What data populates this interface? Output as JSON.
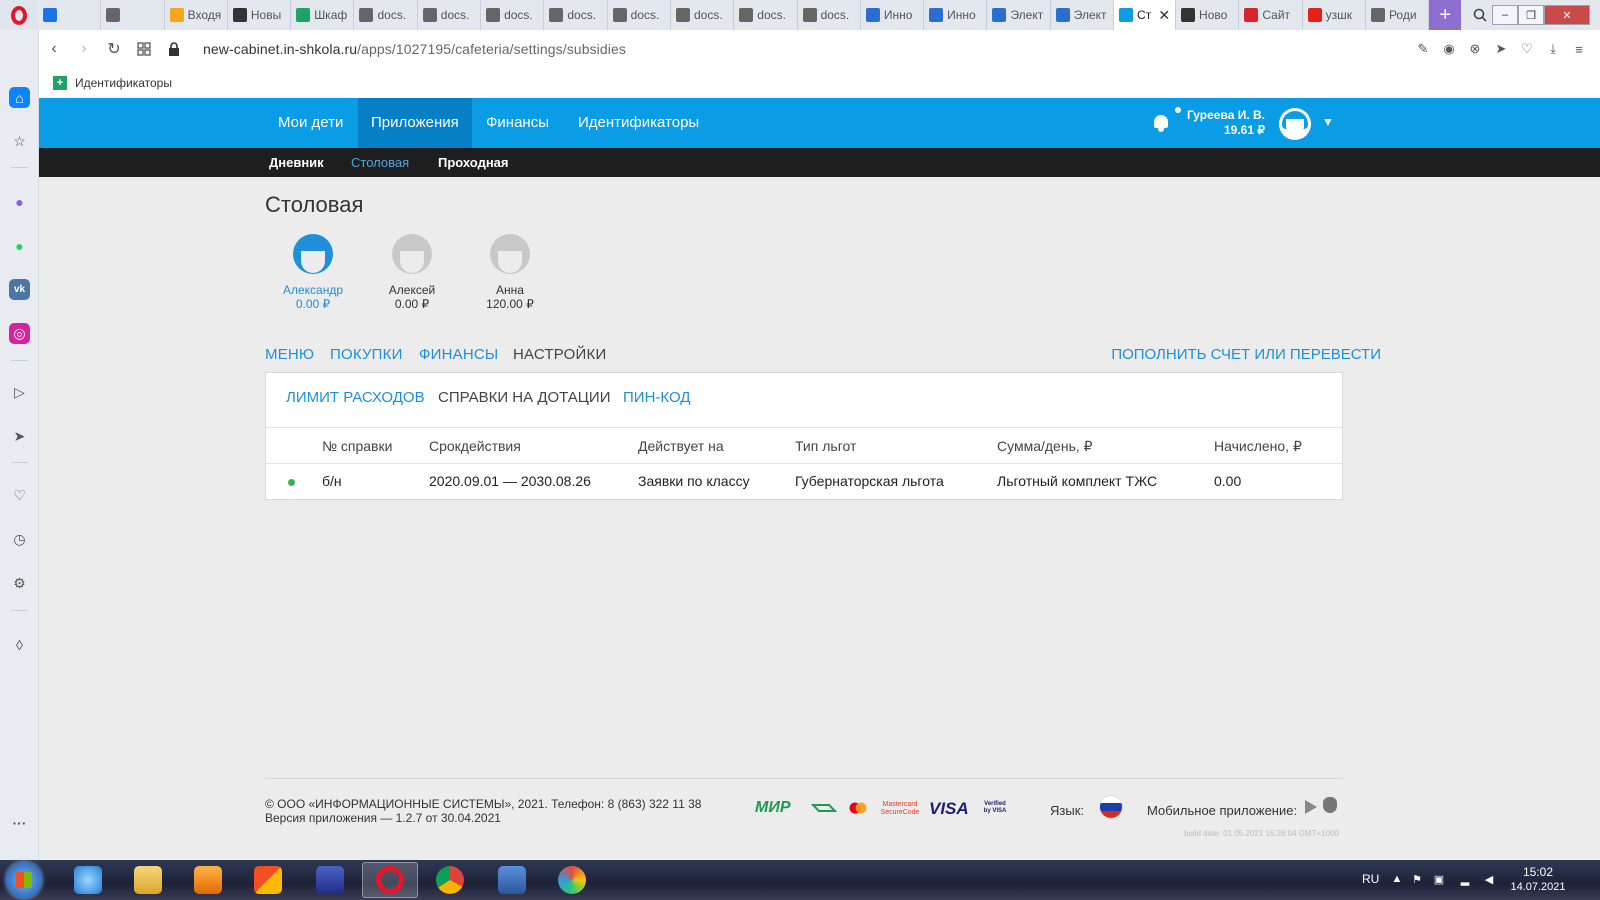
{
  "browser": {
    "tabs": [
      {
        "label": "",
        "icon": "mail-icon",
        "color": "#1a73e8"
      },
      {
        "label": "",
        "icon": "doc-icon",
        "color": "#666666"
      },
      {
        "label": "Входя",
        "icon": "orange-icon",
        "color": "#f7a51d"
      },
      {
        "label": "Новы",
        "icon": "t-icon",
        "color": "#333333"
      },
      {
        "label": "Шкаф",
        "icon": "sheets-icon",
        "color": "#1ea362"
      },
      {
        "label": "docs.",
        "icon": "doc-icon",
        "color": "#666666"
      },
      {
        "label": "docs.",
        "icon": "doc-icon",
        "color": "#666666"
      },
      {
        "label": "docs.",
        "icon": "doc-icon",
        "color": "#666666"
      },
      {
        "label": "docs.",
        "icon": "doc-icon",
        "color": "#666666"
      },
      {
        "label": "docs.",
        "icon": "doc-icon",
        "color": "#666666"
      },
      {
        "label": "docs.",
        "icon": "doc-icon",
        "color": "#666666"
      },
      {
        "label": "docs.",
        "icon": "doc-icon",
        "color": "#666666"
      },
      {
        "label": "docs.",
        "icon": "doc-icon",
        "color": "#666666"
      },
      {
        "label": "Инно",
        "icon": "snowflake-icon",
        "color": "#2a6fd0"
      },
      {
        "label": "Инно",
        "icon": "snowflake-icon",
        "color": "#2a6fd0"
      },
      {
        "label": "Элект",
        "icon": "snowflake-icon",
        "color": "#2a6fd0"
      },
      {
        "label": "Элект",
        "icon": "snowflake-icon",
        "color": "#2a6fd0"
      },
      {
        "label": "Ст",
        "icon": "book-icon",
        "color": "#0a9ce4",
        "active": true
      },
      {
        "label": "Ново",
        "icon": "t-icon",
        "color": "#333333"
      },
      {
        "label": "Сайт",
        "icon": "k-icon",
        "color": "#d9232d"
      },
      {
        "label": "узшк",
        "icon": "yandex-icon",
        "color": "#e62117"
      },
      {
        "label": "Роди",
        "icon": "doc-icon",
        "color": "#666666"
      }
    ],
    "url_host": "new-cabinet.in-shkola.ru",
    "url_path": "/apps/1027195/cafeteria/settings/subsidies",
    "bookmark": "Идентификаторы"
  },
  "nav": {
    "items": [
      "Мои дети",
      "Приложения",
      "Финансы",
      "Идентификаторы"
    ],
    "sub_items": [
      "Дневник",
      "Столовая",
      "Проходная"
    ],
    "user_name": "Гуреева И. В.",
    "user_balance": "19.61 ₽"
  },
  "page": {
    "title": "Столовая",
    "children": [
      {
        "name": "Александр",
        "balance": "0.00 ₽",
        "color": "#1e8fd8"
      },
      {
        "name": "Алексей",
        "balance": "0.00 ₽",
        "color": "#c8c8c8"
      },
      {
        "name": "Анна",
        "balance": "120.00 ₽",
        "color": "#c8c8c8"
      }
    ],
    "tabs": [
      "МЕНЮ",
      "ПОКУПКИ",
      "ФИНАНСЫ",
      "НАСТРОЙКИ"
    ],
    "topup": "ПОПОЛНИТЬ СЧЕТ ИЛИ ПЕРЕВЕСТИ",
    "subtabs": [
      "ЛИМИТ РАСХОДОВ",
      "СПРАВКИ НА ДОТАЦИИ",
      "ПИН-КОД"
    ],
    "table": {
      "headers": [
        "№ справки",
        "Срокдействия",
        "Действует на",
        "Тип льгот",
        "Сумма/день, ₽",
        "Начислено, ₽"
      ],
      "rows": [
        [
          "б/н",
          "2020.09.01 — 2030.08.26",
          "Заявки по классу",
          "Губернаторская льгота",
          "Льготный комплект ТЖС",
          "0.00"
        ]
      ],
      "status_color": "#3bb34a"
    }
  },
  "footer": {
    "copyright": "© ООО «ИНФОРМАЦИОННЫЕ СИСТЕМЫ», 2021. Телефон: 8 (863) 322 11 38",
    "version": "Версия приложения — 1.2.7 от 30.04.2021",
    "payments": [
      "МИР",
      "Mastercard SecureCode",
      "VISA",
      "Verified by VISA"
    ],
    "lang_label": "Язык:",
    "mobile_label": "Мобильное приложение:",
    "build": "build date: 01.05.2021 15:28:04 GMT+1000"
  },
  "taskbar": {
    "lang": "RU",
    "time": "15:02",
    "date": "14.07.2021"
  },
  "colors": {
    "primary": "#0a9ce4",
    "primary_dark": "#0580c6",
    "subnav": "#1e1e1e",
    "link": "#1e8fd8"
  }
}
